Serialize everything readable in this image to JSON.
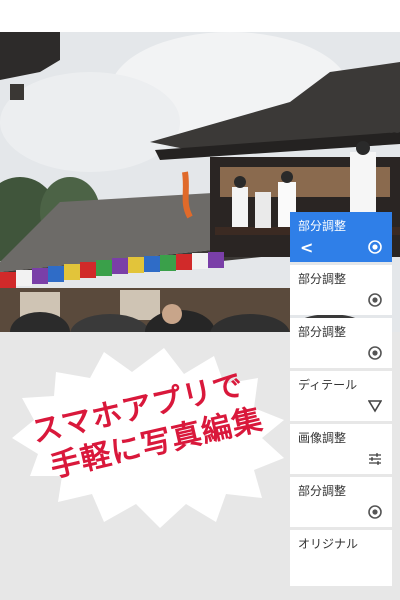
{
  "menu": {
    "items": [
      {
        "label": "部分調整",
        "icon": "radio-target-icon",
        "active": true,
        "back_icon": "<"
      },
      {
        "label": "部分調整",
        "icon": "radio-target-icon"
      },
      {
        "label": "部分調整",
        "icon": "radio-target-icon"
      },
      {
        "label": "ディテール",
        "icon": "triangle-icon"
      },
      {
        "label": "画像調整",
        "icon": "sliders-icon"
      },
      {
        "label": "部分調整",
        "icon": "radio-target-icon"
      },
      {
        "label": "オリジナル",
        "icon": ""
      }
    ]
  },
  "promo": {
    "line1": "スマホアプリで",
    "line2": "手軽に写真編集",
    "color": "#d9183b"
  },
  "colors": {
    "accent": "#2f7fe8",
    "background": "#e7e7e7"
  }
}
